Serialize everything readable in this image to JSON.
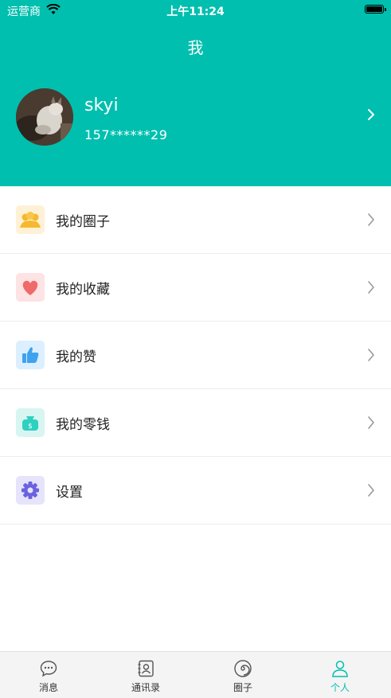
{
  "status_bar": {
    "carrier": "运营商",
    "time": "上午11:24"
  },
  "header": {
    "title": "我"
  },
  "profile": {
    "username": "skyi",
    "phone": "157******29"
  },
  "menu": {
    "items": [
      {
        "label": "我的圈子",
        "icon": "circle-group-icon",
        "icon_bg": "#fff1d6",
        "icon_color": "#f5b82e"
      },
      {
        "label": "我的收藏",
        "icon": "heart-icon",
        "icon_bg": "#fde3e3",
        "icon_color": "#f06a6a"
      },
      {
        "label": "我的赞",
        "icon": "thumbs-up-icon",
        "icon_bg": "#dcefff",
        "icon_color": "#3ea2ee"
      },
      {
        "label": "我的零钱",
        "icon": "wallet-icon",
        "icon_bg": "#d7f5f1",
        "icon_color": "#2ed0c0"
      },
      {
        "label": "设置",
        "icon": "gear-icon",
        "icon_bg": "#e6e4fb",
        "icon_color": "#6b62e0"
      }
    ]
  },
  "tab_bar": {
    "tabs": [
      {
        "label": "消息",
        "icon": "chat-bubble-icon"
      },
      {
        "label": "通讯录",
        "icon": "contacts-icon"
      },
      {
        "label": "圈子",
        "icon": "spiral-icon"
      },
      {
        "label": "个人",
        "icon": "person-icon",
        "active": true
      }
    ]
  },
  "colors": {
    "accent": "#00bfae"
  }
}
